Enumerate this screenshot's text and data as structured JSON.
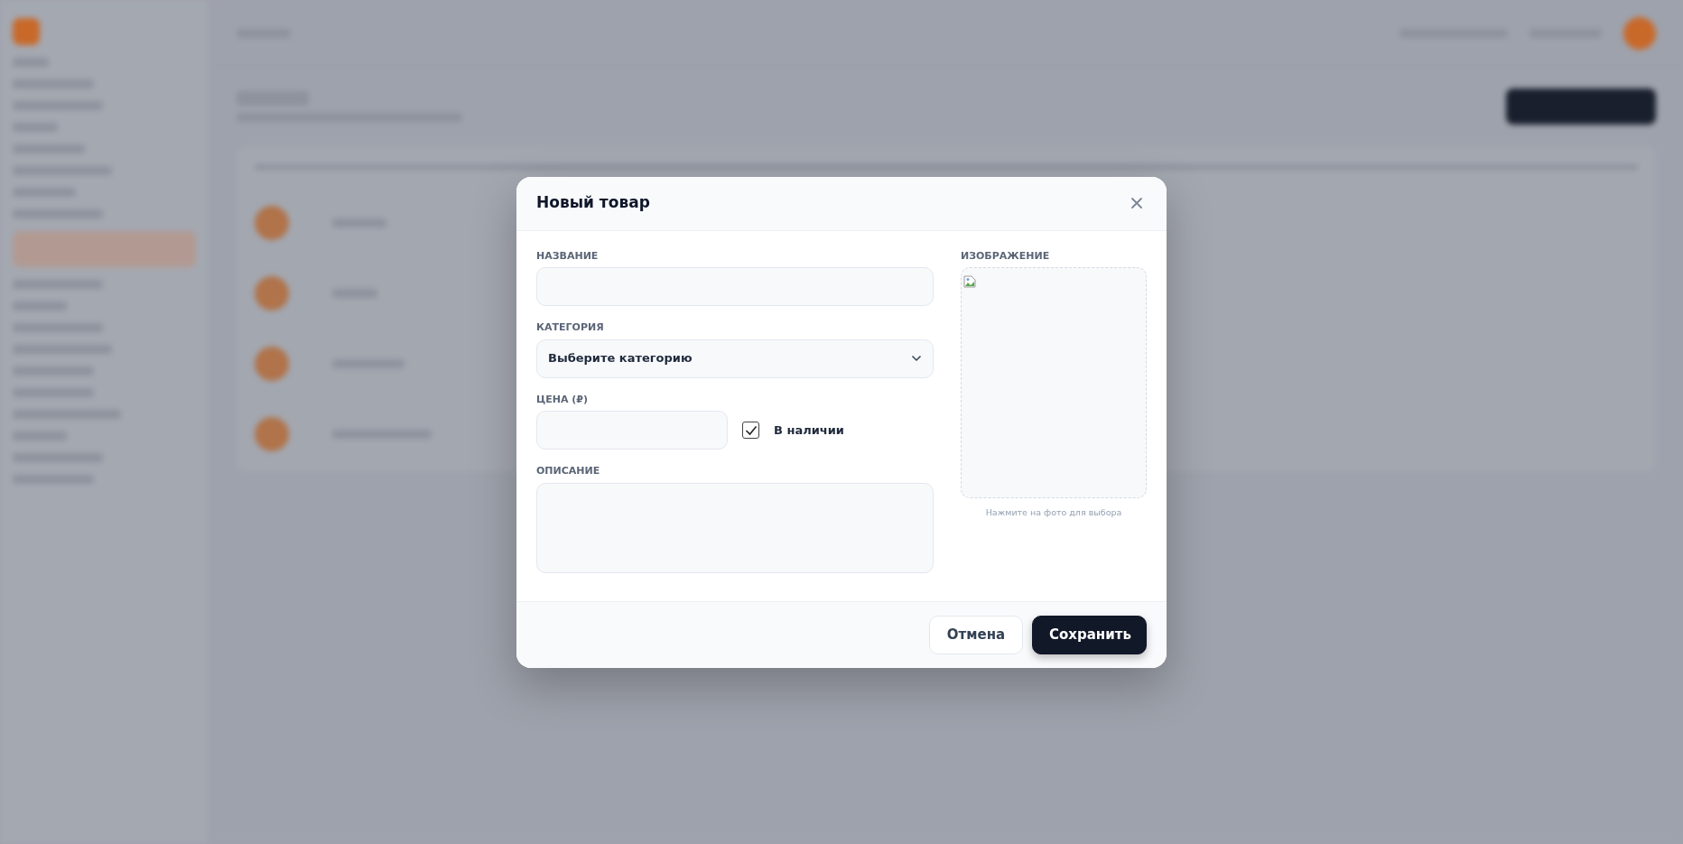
{
  "modal": {
    "title": "Новый товар"
  },
  "form": {
    "name": {
      "label": "НАЗВАНИЕ"
    },
    "category": {
      "label": "КАТЕГОРИЯ",
      "value": "Выберите категорию"
    },
    "price": {
      "label": "ЦЕНА (₽)"
    },
    "in_stock": {
      "label": "В наличии",
      "checked": true
    },
    "description": {
      "label": "ОПИСАНИЕ"
    }
  },
  "image": {
    "label": "ИЗОБРАЖЕНИЕ",
    "hint": "Нажмите на фото для выбора"
  },
  "buttons": [
    {
      "label": "Отмена",
      "kind": "secondary"
    },
    {
      "label": "Сохранить",
      "kind": "primary"
    }
  ]
}
